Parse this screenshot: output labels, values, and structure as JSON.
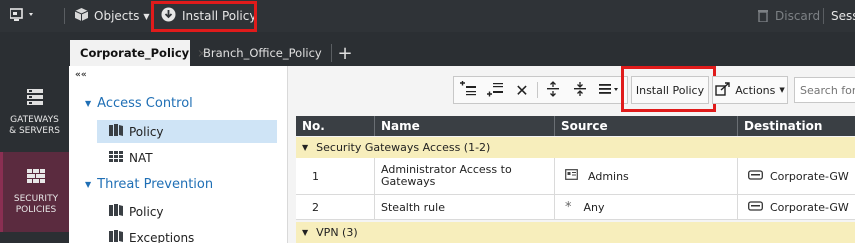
{
  "topbar": {
    "objects_label": "Objects",
    "install_policy_label": "Install Policy",
    "discard_label": "Discard",
    "session_label": "Sess"
  },
  "tabs": [
    {
      "label": "Corporate_Policy",
      "close": "×"
    },
    {
      "label": "Branch_Office_Policy"
    }
  ],
  "tab_add": "+",
  "leftnav": [
    {
      "label": "GATEWAYS & SERVERS"
    },
    {
      "label": "SECURITY POLICIES"
    }
  ],
  "tree": {
    "collapse": "««",
    "access_control": "Access Control",
    "policy": "Policy",
    "nat": "NAT",
    "threat_prevention": "Threat Prevention",
    "tp_policy": "Policy",
    "exceptions": "Exceptions"
  },
  "toolbar": {
    "install_policy_label": "Install Policy",
    "actions_label": "Actions",
    "search_placeholder": "Search for"
  },
  "table": {
    "columns": [
      "No.",
      "Name",
      "Source",
      "Destination"
    ],
    "sections": [
      {
        "label": "Security Gateways Access (1-2)"
      },
      {
        "label": "VPN (3)"
      }
    ],
    "rows": [
      {
        "no": "1",
        "name_line1": "Administrator Access to",
        "name_line2": "Gateways",
        "source": "Admins",
        "destination": "Corporate-GW"
      },
      {
        "no": "2",
        "name_line1": "Stealth rule",
        "name_line2": "",
        "source": "Any",
        "destination": "Corporate-GW"
      }
    ]
  },
  "colors": {
    "highlight_red": "#e01b1b",
    "accent_blue": "#1f6fb5",
    "section_yellow": "#f7eebc",
    "active_nav": "#5b2b3f"
  }
}
